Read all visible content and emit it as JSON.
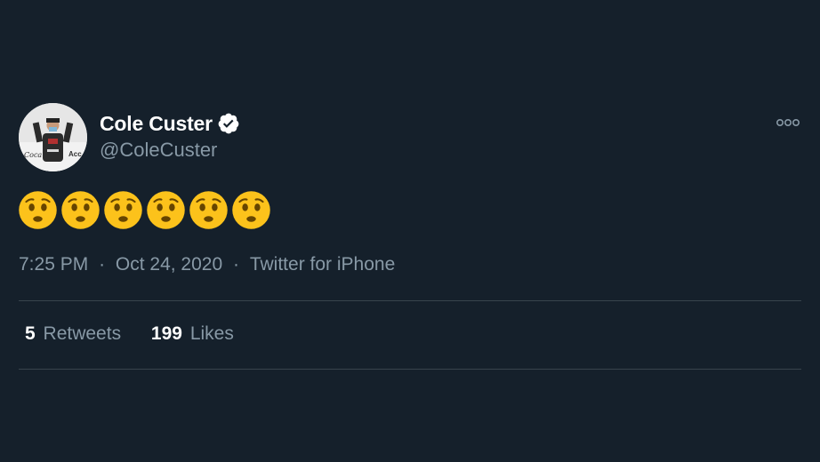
{
  "tweet": {
    "display_name": "Cole Custer",
    "handle": "@ColeCuster",
    "verified": true,
    "emojis": [
      "😟",
      "😟",
      "😟",
      "😟",
      "😟",
      "😟"
    ],
    "emoji_icon": "worried-face-icon",
    "time": "7:25 PM",
    "date": "Oct 24, 2020",
    "source": "Twitter for iPhone",
    "separator": "·"
  },
  "stats": {
    "retweets_count": "5",
    "retweets_label": "Retweets",
    "likes_count": "199",
    "likes_label": "Likes"
  },
  "avatar_logo_left": "Coca-Cola",
  "avatar_logo_right": "Acc",
  "colors": {
    "background": "#15202b",
    "primary_text": "#ffffff",
    "secondary_text": "#8899a6",
    "divider": "#38444d",
    "verified": "#ffffff",
    "emoji_yellow": "#fcc21b"
  }
}
